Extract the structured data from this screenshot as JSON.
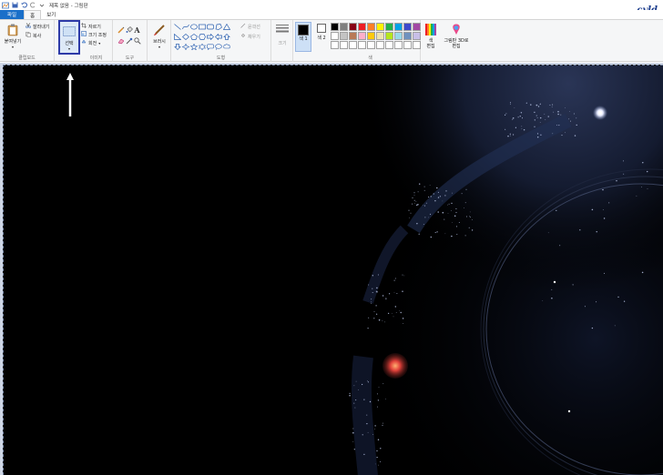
{
  "window": {
    "title": "제목 없음 - 그림판",
    "logo_text": "cyld"
  },
  "tabs": [
    {
      "label": "파일"
    },
    {
      "label": "홈"
    },
    {
      "label": "보기"
    }
  ],
  "ribbon": {
    "clipboard": {
      "paste_label": "붙여넣기",
      "cut_label": "잘라내기",
      "copy_label": "복사",
      "group_label": "클립보드"
    },
    "image": {
      "select_label": "선택",
      "crop_label": "자르기",
      "resize_label": "크기 조정",
      "rotate_label": "회전",
      "group_label": "이미지"
    },
    "tools": {
      "group_label": "도구"
    },
    "brush": {
      "label": "브러시"
    },
    "shapes": {
      "outline_label": "윤곽선",
      "fill_label": "채우기",
      "group_label": "도형"
    },
    "size": {
      "label": "크기"
    },
    "colors": {
      "color1_label": "색 1",
      "color2_label": "색 2",
      "edit_label": "색 편집",
      "group_label": "색",
      "color1_value": "#000000",
      "color2_value": "#ffffff",
      "palette_row1": [
        "#000000",
        "#7f7f7f",
        "#880015",
        "#ed1c24",
        "#ff7f27",
        "#fff200",
        "#22b14c",
        "#00a2e8",
        "#3f48cc",
        "#a349a4"
      ],
      "palette_row2": [
        "#ffffff",
        "#c3c3c3",
        "#b97a57",
        "#ffaec9",
        "#ffc90e",
        "#efe4b0",
        "#b5e61d",
        "#99d9ea",
        "#7092be",
        "#c8bfe7"
      ],
      "palette_row3": [
        "#ffffff",
        "#ffffff",
        "#ffffff",
        "#ffffff",
        "#ffffff",
        "#ffffff",
        "#ffffff",
        "#ffffff",
        "#ffffff",
        "#ffffff"
      ]
    },
    "paint3d": {
      "label": "그림판 3D로 편집"
    }
  }
}
